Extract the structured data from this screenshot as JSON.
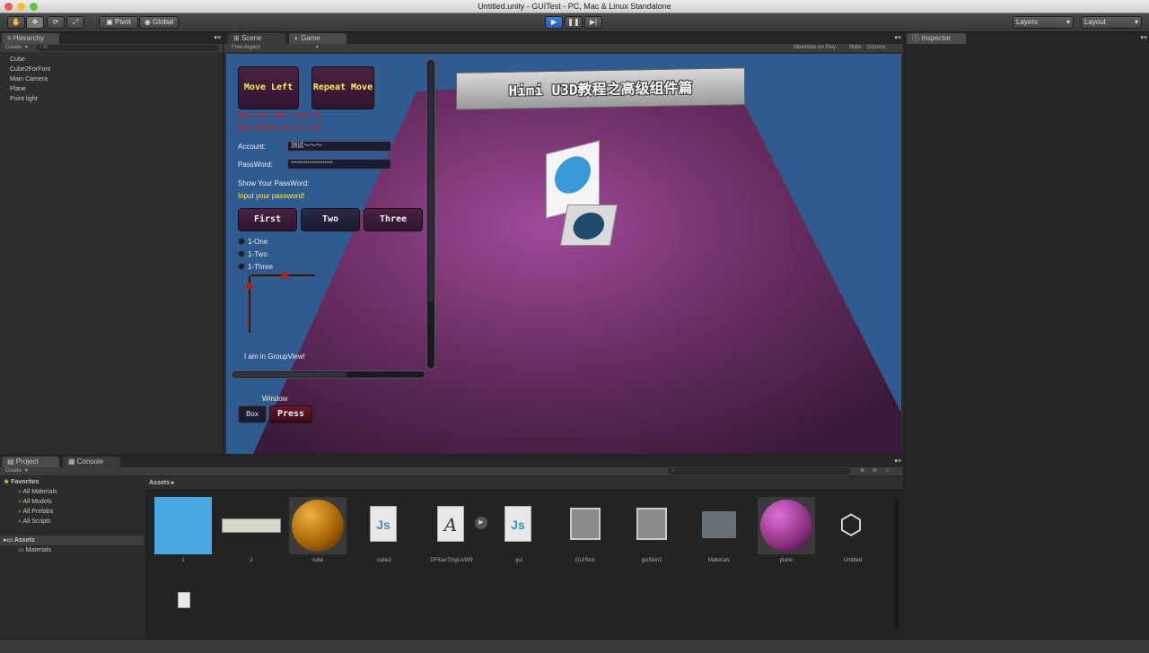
{
  "window": {
    "title": "Untitled.unity - GUITest - PC, Mac & Linux Standalone"
  },
  "toolbar": {
    "pivot_label": "Pivot",
    "global_label": "Global",
    "layers_label": "Layers",
    "layout_label": "Layout"
  },
  "hierarchy": {
    "tab": "Hierarchy",
    "create_label": "Create",
    "search_placeholder": "All",
    "items": [
      "Cube",
      "Cube2ForFont",
      "Main Camera",
      "Plane",
      "Point light"
    ]
  },
  "scene_tabs": {
    "scene": "Scene",
    "game": "Game"
  },
  "game": {
    "aspect_label": "Free Aspect",
    "maximize_label": "Maximize on Play",
    "stats_label": "Stats",
    "gizmos_label": "Gizmos",
    "banner_text": "Himi U3D教程之高级组件篇",
    "move_left": "Move Left",
    "repeat_move": "Repeat Move",
    "error_line1": "Image both 500, Count 00",
    "error_line2": "Image Both 500, Count 00",
    "account_label": "Account:",
    "account_value": "测试～～～",
    "password_label": "PassWord:",
    "password_value": "********************",
    "show_password_label": "Show Your PassWord:",
    "input_password_label": "Input your password!",
    "toolbar_buttons": [
      "First",
      "Two",
      "Three"
    ],
    "radios": [
      "1-One",
      "1-Two",
      "1-Three"
    ],
    "groupview_label": "I am in GroupView!",
    "window_label": "Window",
    "box_label": "Box",
    "press_label": "Press"
  },
  "inspector": {
    "tab": "Inspector"
  },
  "project": {
    "tab": "Project",
    "console_tab": "Console",
    "create_label": "Create",
    "favorites_label": "Favorites",
    "favorites": [
      "All Materials",
      "All Models",
      "All Prefabs",
      "All Scripts"
    ],
    "assets_label": "Assets",
    "assets_children": [
      "Materials"
    ],
    "breadcrumb": "Assets",
    "asset_items": [
      {
        "name": "1",
        "icon": "avatar-icon"
      },
      {
        "name": "2",
        "icon": "texture-icon"
      },
      {
        "name": "cube",
        "icon": "orange-sphere-icon"
      },
      {
        "name": "cube2",
        "icon": "js-script-icon"
      },
      {
        "name": "DFKanTingLiuW9",
        "icon": "font-icon"
      },
      {
        "name": "gui",
        "icon": "js-script-icon"
      },
      {
        "name": "GUISkin",
        "icon": "guiskin-icon"
      },
      {
        "name": "guiSkin2",
        "icon": "guiskin-icon"
      },
      {
        "name": "Materials",
        "icon": "folder-icon"
      },
      {
        "name": "plane",
        "icon": "purple-sphere-icon"
      },
      {
        "name": "Untitled",
        "icon": "unity-logo-icon"
      }
    ]
  },
  "colors": {
    "game_bg": "#2e5a8e",
    "plane": "#5a2a55",
    "button_text_yellow": "#ffee55",
    "error_red": "#cc2222"
  }
}
